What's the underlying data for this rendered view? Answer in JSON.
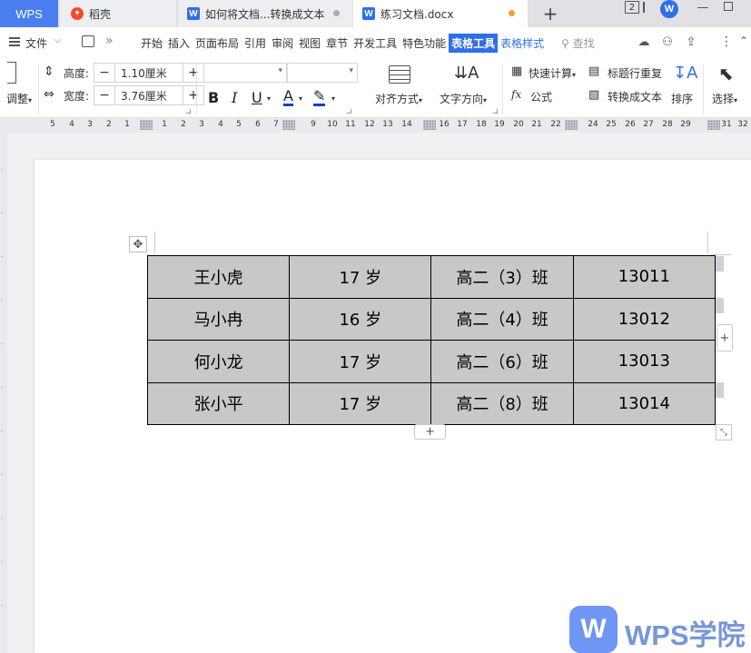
{
  "tabs": {
    "wps": "WPS",
    "daoke": "稻壳",
    "doc1": "如何将文档...转换成文本",
    "doc2": "练习文档.docx",
    "window_count": "2"
  },
  "menu": {
    "file": "文件",
    "items": [
      "开始",
      "插入",
      "页面布局",
      "引用",
      "审阅",
      "视图",
      "章节",
      "开发工具",
      "特色功能",
      "表格工具",
      "表格样式"
    ],
    "search": "查找"
  },
  "ribbon": {
    "adjust": "调整",
    "height_label": "高度:",
    "height_value": "1.10厘米",
    "width_label": "宽度:",
    "width_value": "3.76厘米",
    "align": "对齐方式",
    "text_direction": "文字方向",
    "quick_calc": "快速计算",
    "repeat_header": "标题行重复",
    "formula": "公式",
    "convert_text": "转换成文本",
    "sort": "排序",
    "select": "选择",
    "colors": {
      "font_color": "#1a3ad6",
      "highlight": "#1a3ad6"
    }
  },
  "ruler": [
    "5",
    "4",
    "3",
    "2",
    "1",
    "1",
    "2",
    "3",
    "4",
    "5",
    "6",
    "7",
    "8",
    "9",
    "10",
    "11",
    "12",
    "13",
    "14",
    "15",
    "16",
    "17",
    "18",
    "19",
    "20",
    "21",
    "22",
    "24",
    "25",
    "26",
    "27",
    "28",
    "29",
    "30",
    "31",
    "32"
  ],
  "table": {
    "rows": [
      [
        "王小虎",
        "17 岁",
        "高二（3）班",
        "13011"
      ],
      [
        "马小冉",
        "16 岁",
        "高二（4）班",
        "13012"
      ],
      [
        "何小龙",
        "17 岁",
        "高二（6）班",
        "13013"
      ],
      [
        "张小平",
        "17 岁",
        "高二（8）班",
        "13014"
      ]
    ]
  },
  "watermark": {
    "text": "WPS学院",
    "logo": "W"
  }
}
